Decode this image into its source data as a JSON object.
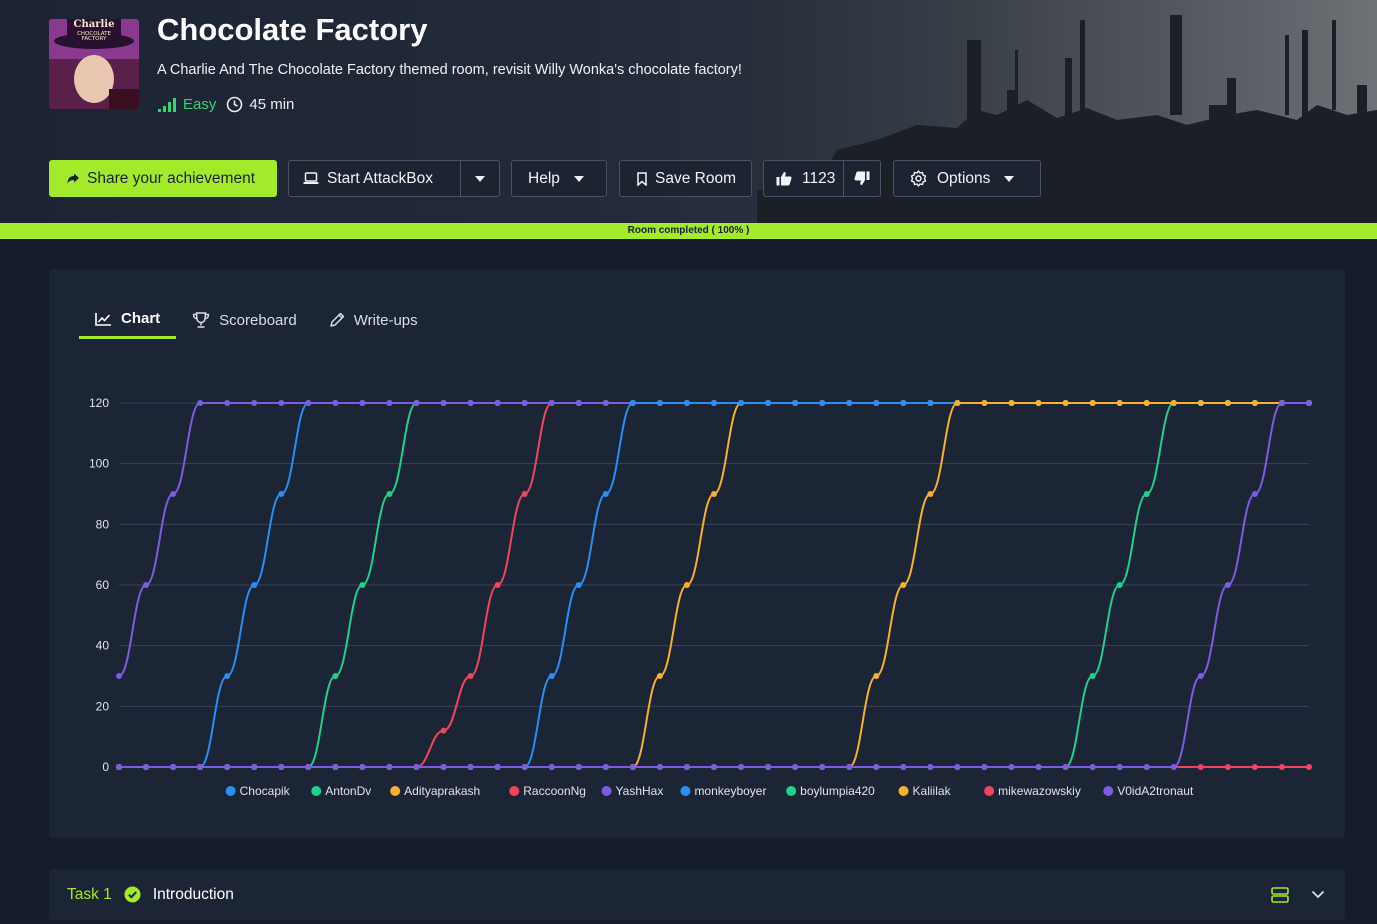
{
  "room": {
    "title": "Chocolate Factory",
    "subtitle": "A Charlie And The Chocolate Factory themed room, revisit Willy Wonka's chocolate factory!",
    "difficulty": "Easy",
    "duration": "45 min",
    "thumbnail_text": [
      "Charlie",
      "CHOCOLATE",
      "FACTORY"
    ]
  },
  "toolbar": {
    "share_label": "Share your achievement",
    "attackbox_label": "Start AttackBox",
    "help_label": "Help",
    "save_label": "Save Room",
    "likes": "1123",
    "options_label": "Options"
  },
  "progress": {
    "label": "Room completed ( 100% )",
    "value": 100
  },
  "tabs": [
    {
      "label": "Chart",
      "active": true
    },
    {
      "label": "Scoreboard",
      "active": false
    },
    {
      "label": "Write-ups",
      "active": false
    }
  ],
  "chart_data": {
    "type": "line",
    "ylim": [
      0,
      120
    ],
    "yticks": [
      0,
      20,
      40,
      60,
      80,
      100,
      120
    ],
    "x_count": 45,
    "series": [
      {
        "name": "Chocapik",
        "color": "#2b8ef0",
        "values": [
          0,
          0,
          0,
          0,
          30,
          60,
          90,
          120,
          120,
          120,
          120,
          120,
          120,
          120,
          120,
          120,
          120,
          120,
          120,
          120,
          120,
          120,
          120,
          120,
          120,
          120,
          120,
          120,
          120,
          120,
          120,
          120,
          120,
          120,
          120,
          120,
          120,
          120,
          120,
          120,
          120,
          120,
          120,
          120,
          120
        ]
      },
      {
        "name": "AntonDv",
        "color": "#1fd18a",
        "values": [
          0,
          0,
          0,
          0,
          0,
          0,
          0,
          0,
          30,
          60,
          90,
          120,
          120,
          120,
          120,
          120,
          120,
          120,
          120,
          120,
          120,
          120,
          120,
          120,
          120,
          120,
          120,
          120,
          120,
          120,
          120,
          120,
          120,
          120,
          120,
          120,
          120,
          120,
          120,
          120,
          120,
          120,
          120,
          120,
          120
        ]
      },
      {
        "name": "Adityaprakash",
        "color": "#f8b12c",
        "values": [
          0,
          0,
          0,
          0,
          0,
          0,
          0,
          0,
          0,
          0,
          0,
          0,
          0,
          0,
          0,
          0,
          0,
          0,
          0,
          0,
          30,
          60,
          90,
          120,
          120,
          120,
          120,
          120,
          120,
          120,
          120,
          120,
          120,
          120,
          120,
          120,
          120,
          120,
          120,
          120,
          120,
          120,
          120,
          120,
          120
        ]
      },
      {
        "name": "RaccoonNg",
        "color": "#f0455e",
        "values": [
          0,
          0,
          0,
          0,
          0,
          0,
          0,
          0,
          0,
          0,
          0,
          0,
          12,
          30,
          60,
          90,
          120,
          120,
          120,
          120,
          120,
          120,
          120,
          120,
          120,
          120,
          120,
          120,
          120,
          120,
          120,
          120,
          120,
          120,
          120,
          120,
          120,
          120,
          120,
          120,
          120,
          120,
          120,
          120,
          120
        ]
      },
      {
        "name": "YashHax",
        "color": "#7c5ce0",
        "values": [
          30,
          60,
          90,
          120,
          120,
          120,
          120,
          120,
          120,
          120,
          120,
          120,
          120,
          120,
          120,
          120,
          120,
          120,
          120,
          120,
          120,
          120,
          120,
          120,
          120,
          120,
          120,
          120,
          120,
          120,
          120,
          120,
          120,
          120,
          120,
          120,
          120,
          120,
          120,
          120,
          120,
          120,
          120,
          120,
          120
        ]
      },
      {
        "name": "monkeyboyer",
        "color": "#2b8ef0",
        "values": [
          0,
          0,
          0,
          0,
          0,
          0,
          0,
          0,
          0,
          0,
          0,
          0,
          0,
          0,
          0,
          0,
          30,
          60,
          90,
          120,
          120,
          120,
          120,
          120,
          120,
          120,
          120,
          120,
          120,
          120,
          120,
          120,
          120,
          120,
          120,
          120,
          120,
          120,
          120,
          120,
          120,
          120,
          120,
          120,
          120
        ]
      },
      {
        "name": "boylumpia420",
        "color": "#1fd18a",
        "values": [
          0,
          0,
          0,
          0,
          0,
          0,
          0,
          0,
          0,
          0,
          0,
          0,
          0,
          0,
          0,
          0,
          0,
          0,
          0,
          0,
          0,
          0,
          0,
          0,
          0,
          0,
          0,
          0,
          0,
          0,
          0,
          0,
          0,
          0,
          0,
          0,
          30,
          60,
          90,
          120,
          120,
          120,
          120,
          120,
          120
        ]
      },
      {
        "name": "Kaliilak",
        "color": "#f8b12c",
        "values": [
          0,
          0,
          0,
          0,
          0,
          0,
          0,
          0,
          0,
          0,
          0,
          0,
          0,
          0,
          0,
          0,
          0,
          0,
          0,
          0,
          0,
          0,
          0,
          0,
          0,
          0,
          0,
          0,
          30,
          60,
          90,
          120,
          120,
          120,
          120,
          120,
          120,
          120,
          120,
          120,
          120,
          120,
          120,
          120,
          120
        ]
      },
      {
        "name": "mikewazowskiy",
        "color": "#f0455e",
        "values": [
          0,
          0,
          0,
          0,
          0,
          0,
          0,
          0,
          0,
          0,
          0,
          0,
          0,
          0,
          0,
          0,
          0,
          0,
          0,
          0,
          0,
          0,
          0,
          0,
          0,
          0,
          0,
          0,
          0,
          0,
          0,
          0,
          0,
          0,
          0,
          0,
          0,
          0,
          0,
          0,
          0,
          0,
          0,
          0,
          0
        ]
      },
      {
        "name": "V0idA2tronaut",
        "color": "#7c5ce0",
        "values": [
          0,
          0,
          0,
          0,
          0,
          0,
          0,
          0,
          0,
          0,
          0,
          0,
          0,
          0,
          0,
          0,
          0,
          0,
          0,
          0,
          0,
          0,
          0,
          0,
          0,
          0,
          0,
          0,
          0,
          0,
          0,
          0,
          0,
          0,
          0,
          0,
          0,
          0,
          0,
          0,
          30,
          60,
          90,
          120,
          120
        ]
      }
    ]
  },
  "task": {
    "number": "Task 1",
    "title": "Introduction"
  }
}
